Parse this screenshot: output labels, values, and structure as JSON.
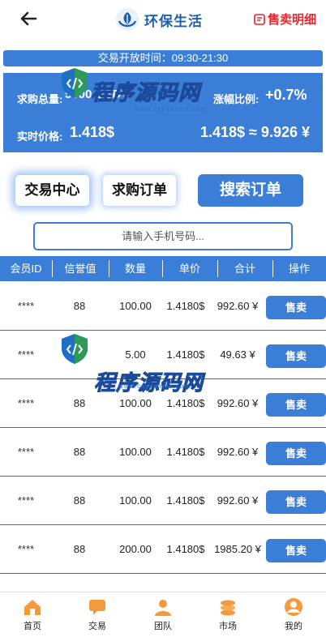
{
  "header": {
    "title": "环保生活",
    "sell_detail": "售卖明细"
  },
  "hours": {
    "text": "交易开放时间：09:30-21:30"
  },
  "stats": {
    "total_label": "求购总量:",
    "total_value": "5000 USDT",
    "rise_label": "涨幅比例:",
    "rise_value": "+0.7%",
    "price_label": "实时价格:",
    "price_value": "1.418$",
    "conversion": "1.418$ ≈ 9.926 ¥"
  },
  "tabs": {
    "trade_center": "交易中心",
    "buy_orders": "求购订单",
    "search_orders": "搜索订单"
  },
  "search": {
    "placeholder": "请输入手机号码..."
  },
  "table": {
    "headers": [
      "会员ID",
      "信誉值",
      "数量",
      "单价",
      "合计",
      "操作"
    ],
    "rows": [
      {
        "id": "****",
        "credit": "88",
        "qty": "100.00",
        "price": "1.4180$",
        "total": "992.60 ¥",
        "action": "售卖"
      },
      {
        "id": "****",
        "credit": "88",
        "qty": "5.00",
        "price": "1.4180$",
        "total": "49.63 ¥",
        "action": "售卖"
      },
      {
        "id": "****",
        "credit": "88",
        "qty": "100.00",
        "price": "1.4180$",
        "total": "992.60 ¥",
        "action": "售卖"
      },
      {
        "id": "****",
        "credit": "88",
        "qty": "100.00",
        "price": "1.4180$",
        "total": "992.60 ¥",
        "action": "售卖"
      },
      {
        "id": "****",
        "credit": "88",
        "qty": "100.00",
        "price": "1.4180$",
        "total": "992.60 ¥",
        "action": "售卖"
      },
      {
        "id": "****",
        "credit": "88",
        "qty": "200.00",
        "price": "1.4180$",
        "total": "1985.20 ¥",
        "action": "售卖"
      }
    ]
  },
  "watermark": {
    "cn": "程序源码网",
    "en": "www.cxyuanma.com"
  },
  "nav": {
    "items": [
      {
        "label": "首页",
        "icon": "home-icon"
      },
      {
        "label": "交易",
        "icon": "chat-icon"
      },
      {
        "label": "团队",
        "icon": "team-icon"
      },
      {
        "label": "市场",
        "icon": "coins-icon"
      },
      {
        "label": "我的",
        "icon": "profile-icon"
      }
    ]
  },
  "colors": {
    "primary": "#3b7ed8",
    "brand_text": "#1f5fae",
    "danger": "#e8262d",
    "nav_icon": "#f29a3c"
  }
}
